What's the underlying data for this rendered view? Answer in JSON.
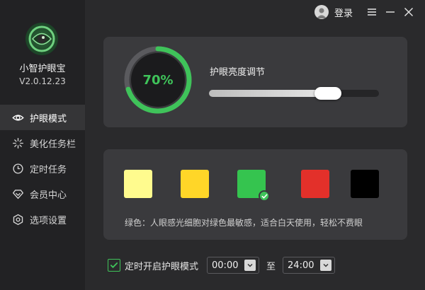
{
  "app": {
    "name": "小智护眼宝",
    "version": "V2.0.12.23"
  },
  "topbar": {
    "login_label": "登录"
  },
  "sidebar": {
    "items": [
      {
        "label": "护眼模式",
        "icon": "eye-icon",
        "active": true
      },
      {
        "label": "美化任务栏",
        "icon": "sparkle-icon",
        "active": false
      },
      {
        "label": "定时任务",
        "icon": "clock-icon",
        "active": false
      },
      {
        "label": "会员中心",
        "icon": "diamond-icon",
        "active": false
      },
      {
        "label": "选项设置",
        "icon": "settings-icon",
        "active": false
      }
    ]
  },
  "brightness": {
    "title": "护眼亮度调节",
    "value_label": "70%",
    "ring_percent": 70,
    "slider_percent": 70
  },
  "colors": {
    "swatches": [
      {
        "name": "pale-yellow",
        "color": "#fffb8e",
        "selected": false
      },
      {
        "name": "yellow",
        "color": "#ffd628",
        "selected": false
      },
      {
        "name": "green",
        "color": "#35c44f",
        "selected": true
      },
      {
        "name": "red",
        "color": "#e3302a",
        "selected": false
      },
      {
        "name": "black",
        "color": "#000000",
        "selected": false
      }
    ],
    "description": "绿色：人眼感光细胞对绿色最敏感，适合白天使用，轻松不费眼"
  },
  "schedule": {
    "checked": true,
    "label": "定时开启护眼模式",
    "start": "00:00",
    "to_label": "至",
    "end": "24:00"
  },
  "theme": {
    "accent": "#3fc35a",
    "bg": "#2a2a2c",
    "sidebar_bg": "#222224",
    "card_bg": "#3a3a3d"
  }
}
